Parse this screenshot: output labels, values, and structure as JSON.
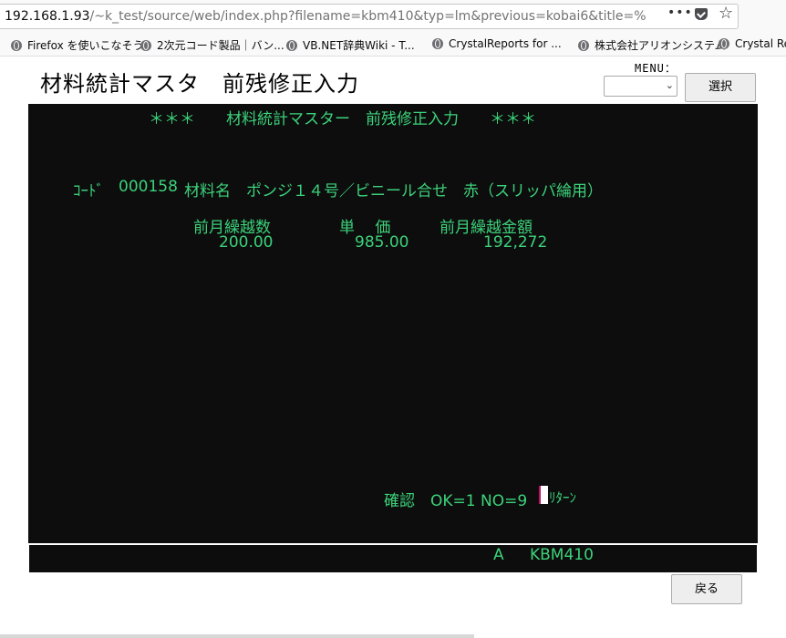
{
  "browser": {
    "url_host": "192.168.1.93",
    "url_path": "/~k_test/source/web/index.php?filename=kbm410&typ=lm&previous=kobai6&title=%",
    "more_icon": "ellipsis-icon",
    "bookmarks": [
      {
        "label": "Firefox を使いこなそう"
      },
      {
        "label": "2次元コード製品｜バン..."
      },
      {
        "label": "VB.NET辞典Wiki - T..."
      },
      {
        "label": "CrystalReports for ..."
      },
      {
        "label": "株式会社アリオンシステム"
      },
      {
        "label": "Crystal Re"
      }
    ]
  },
  "page": {
    "title": "材料統計マスタ　前残修正入力",
    "menu_label": "MENU：",
    "menu_value": "",
    "select_label": "選択",
    "back_label": "戻る"
  },
  "terminal": {
    "header": "＊＊＊　　材料統計マスター　前残修正入力　　＊＊＊",
    "code_label": "ｺｰﾄﾞ",
    "code_value": "000158",
    "material_label": "材料名",
    "material_value": "ポンジ１４号／ビニール合せ　赤（スリッパ綸用）",
    "col_prev_qty": "前月繰越数",
    "col_unit_price": "単　 価",
    "col_prev_amount": "前月繰越金額",
    "prev_qty": "200.00",
    "unit_price": "985.00",
    "prev_amount": "192,272",
    "confirm_prompt": "確認　OK=1 NO=9",
    "return_hint": "ﾘﾀｰﾝ",
    "status_mode": "A",
    "status_program": "KBM410"
  },
  "colors": {
    "terminal_bg": "#0d0d0d",
    "terminal_text": "#3cd27a"
  }
}
